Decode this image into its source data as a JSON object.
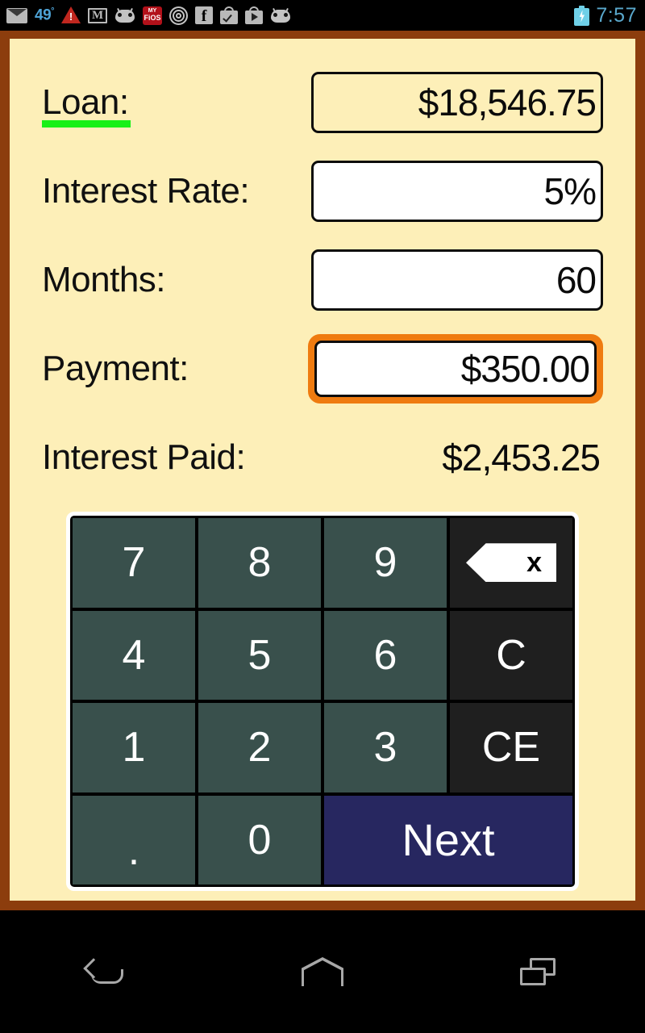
{
  "status_bar": {
    "temperature": "49",
    "temperature_unit": "°",
    "time": "7:57",
    "left_icons": [
      {
        "name": "email-icon",
        "label": "email"
      },
      {
        "name": "warning-icon",
        "label": "!"
      },
      {
        "name": "gmail-icon",
        "label": "M"
      },
      {
        "name": "cyanogenmod-icon",
        "label": "android"
      },
      {
        "name": "myfios-icon",
        "label_top": "MY",
        "label_bottom": "FiOS"
      },
      {
        "name": "rings-icon",
        "label": "rings"
      },
      {
        "name": "facebook-icon",
        "label": "f"
      },
      {
        "name": "play-store-installed-icon",
        "label": "bag-check"
      },
      {
        "name": "play-store-icon",
        "label": "bag-play"
      },
      {
        "name": "cyanogenmod-icon-2",
        "label": "android"
      }
    ],
    "battery_icon": "battery-charging-icon",
    "colors": {
      "temperature": "#4ea3d6",
      "clock": "#5aa8cc",
      "battery": "#6fd0e8",
      "warning": "#c0271f",
      "fios": "#b2111a"
    }
  },
  "app": {
    "frame_color": "#8c3d0d",
    "background_color": "#fdefb8",
    "accent_focus_color": "#ef7b10",
    "accent_underline_color": "#18f018",
    "fields": [
      {
        "id": "loan",
        "label": "Loan:",
        "value": "$18,546.75",
        "active_label": true,
        "focused": false,
        "transparent": true,
        "editable": true
      },
      {
        "id": "interest-rate",
        "label": "Interest Rate:",
        "value": "5%",
        "active_label": false,
        "focused": false,
        "transparent": false,
        "editable": true
      },
      {
        "id": "months",
        "label": "Months:",
        "value": "60",
        "active_label": false,
        "focused": false,
        "transparent": false,
        "editable": true
      },
      {
        "id": "payment",
        "label": "Payment:",
        "value": "$350.00",
        "active_label": false,
        "focused": true,
        "transparent": false,
        "editable": true
      }
    ],
    "result": {
      "label": "Interest Paid:",
      "value": "$2,453.25"
    },
    "keypad": {
      "keys": [
        {
          "id": "key-7",
          "label": "7",
          "type": "num"
        },
        {
          "id": "key-8",
          "label": "8",
          "type": "num"
        },
        {
          "id": "key-9",
          "label": "9",
          "type": "num"
        },
        {
          "id": "key-backspace",
          "label": "x",
          "type": "backspace"
        },
        {
          "id": "key-4",
          "label": "4",
          "type": "num"
        },
        {
          "id": "key-5",
          "label": "5",
          "type": "num"
        },
        {
          "id": "key-6",
          "label": "6",
          "type": "num"
        },
        {
          "id": "key-c",
          "label": "C",
          "type": "fn"
        },
        {
          "id": "key-1",
          "label": "1",
          "type": "num"
        },
        {
          "id": "key-2",
          "label": "2",
          "type": "num"
        },
        {
          "id": "key-3",
          "label": "3",
          "type": "num"
        },
        {
          "id": "key-ce",
          "label": "CE",
          "type": "fn"
        },
        {
          "id": "key-dot",
          "label": ".",
          "type": "num"
        },
        {
          "id": "key-0",
          "label": "0",
          "type": "num"
        },
        {
          "id": "key-next",
          "label": "Next",
          "type": "next"
        }
      ],
      "colors": {
        "number_key": "#39504c",
        "function_key": "#1f1f1f",
        "next_key": "#272760",
        "border": "#ffffff"
      }
    }
  },
  "nav_bar": {
    "back_label": "Back",
    "home_label": "Home",
    "recents_label": "Recents"
  }
}
